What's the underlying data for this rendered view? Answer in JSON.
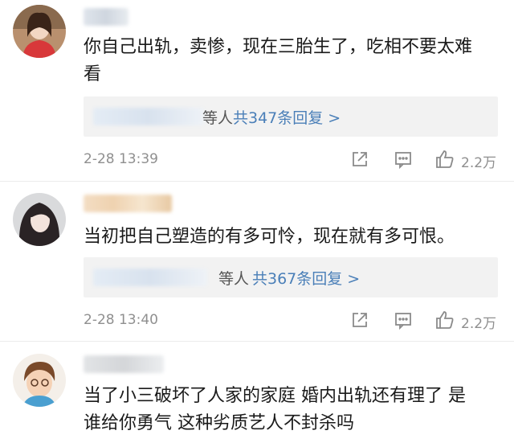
{
  "comments": [
    {
      "text": "你自己出轨，卖惨，现在三胎生了，吃相不要太难\n看",
      "reply_suffix": "等人",
      "reply_count": "共347条回复 >",
      "time": "2-28 13:39",
      "likes": "2.2万"
    },
    {
      "text": "当初把自己塑造的有多可怜，现在就有多可恨。",
      "reply_suffix": "等人",
      "reply_count": "共367条回复 >",
      "time": "2-28 13:40",
      "likes": "2.2万"
    },
    {
      "text": "当了小三破坏了人家的家庭 婚内出轨还有理了 是\n谁给你勇气 这种劣质艺人不封杀吗"
    }
  ],
  "icons": [
    "share-icon",
    "comment-icon",
    "like-icon"
  ],
  "colors": {
    "link": "#4a7fb8",
    "meta": "#8f8f8f",
    "reply_bg": "#f2f2f2"
  }
}
